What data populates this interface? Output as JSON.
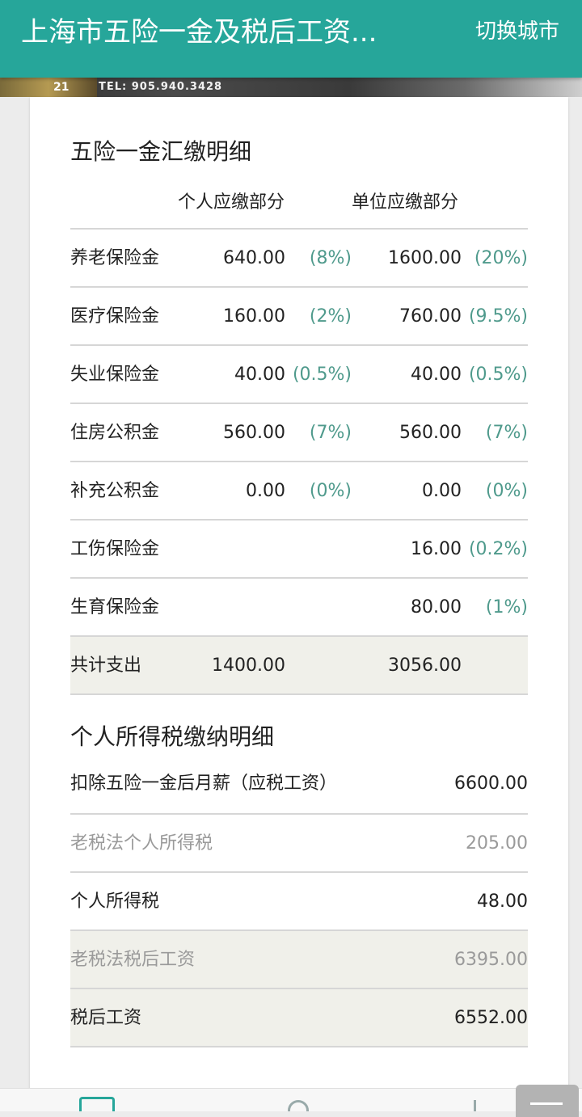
{
  "header": {
    "title": "上海市五险一金及税后工资...",
    "switch_city": "切换城市"
  },
  "banner": {
    "tel": "TEL: 905.940.3428",
    "logo_text": "21"
  },
  "insurance": {
    "section_title": "五险一金汇缴明细",
    "col_personal": "个人应缴部分",
    "col_company": "单位应缴部分",
    "rows": [
      {
        "label": "养老保险金",
        "personal": "640.00",
        "personal_pct": "(8%)",
        "company": "1600.00",
        "company_pct": "(20%)"
      },
      {
        "label": "医疗保险金",
        "personal": "160.00",
        "personal_pct": "(2%)",
        "company": "760.00",
        "company_pct": "(9.5%)"
      },
      {
        "label": "失业保险金",
        "personal": "40.00",
        "personal_pct": "(0.5%)",
        "company": "40.00",
        "company_pct": "(0.5%)"
      },
      {
        "label": "住房公积金",
        "personal": "560.00",
        "personal_pct": "(7%)",
        "company": "560.00",
        "company_pct": "(7%)"
      },
      {
        "label": "补充公积金",
        "personal": "0.00",
        "personal_pct": "(0%)",
        "company": "0.00",
        "company_pct": "(0%)"
      },
      {
        "label": "工伤保险金",
        "personal": "",
        "personal_pct": "",
        "company": "16.00",
        "company_pct": "(0.2%)"
      },
      {
        "label": "生育保险金",
        "personal": "",
        "personal_pct": "",
        "company": "80.00",
        "company_pct": "(1%)"
      }
    ],
    "total": {
      "label": "共计支出",
      "personal": "1400.00",
      "company": "3056.00"
    }
  },
  "tax": {
    "section_title": "个人所得税缴纳明细",
    "rows": [
      {
        "label": "扣除五险一金后月薪（应税工资）",
        "value": "6600.00"
      },
      {
        "label": "老税法个人所得税",
        "value": "205.00"
      },
      {
        "label": "个人所得税",
        "value": "48.00"
      },
      {
        "label": "老税法税后工资",
        "value": "6395.00"
      },
      {
        "label": "税后工资",
        "value": "6552.00"
      }
    ]
  },
  "colors": {
    "accent": "#26a69a",
    "percent": "#4f9a8c",
    "muted": "#9a9a9a",
    "shade": "#f0f0ea"
  }
}
